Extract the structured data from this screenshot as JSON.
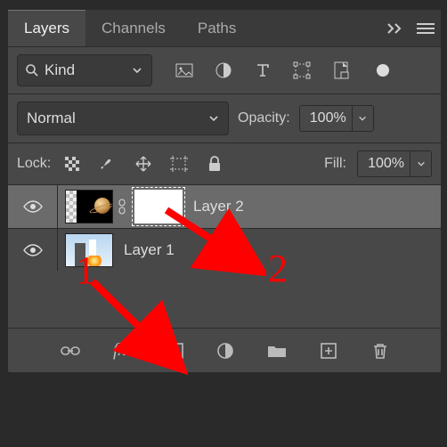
{
  "tabs": {
    "layers": "Layers",
    "channels": "Channels",
    "paths": "Paths"
  },
  "filter": {
    "kind_label": "Kind"
  },
  "blend": {
    "mode": "Normal"
  },
  "opacity": {
    "label": "Opacity:",
    "value": "100%"
  },
  "lock": {
    "label": "Lock:"
  },
  "fill": {
    "label": "Fill:",
    "value": "100%"
  },
  "layers": [
    {
      "name": "Layer 2"
    },
    {
      "name": "Layer 1"
    }
  ],
  "annotations": {
    "num1": "1",
    "num2": "2"
  }
}
